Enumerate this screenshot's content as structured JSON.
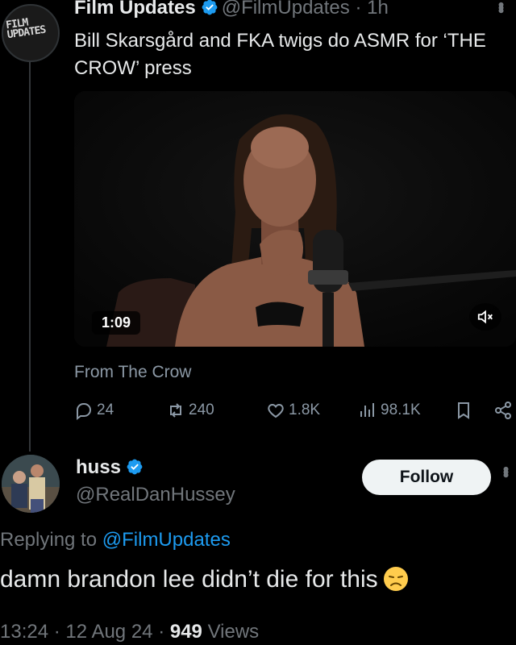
{
  "tweet": {
    "author_name": "Film Updates",
    "author_handle": "@FilmUpdates",
    "separator": "·",
    "time": "1h",
    "avatar_logo_line1": "FILM",
    "avatar_logo_line2": "UPDATES",
    "text": "Bill Skarsgård and FKA twigs do ASMR for ‘THE CROW’ press",
    "video_duration": "1:09",
    "source": "From The Crow",
    "actions": {
      "replies": "24",
      "reposts": "240",
      "likes": "1.8K",
      "views": "98.1K"
    }
  },
  "reply": {
    "author_name": "huss",
    "author_handle": "@RealDanHussey",
    "follow_label": "Follow",
    "replying_prefix": "Replying to",
    "replying_to": "@FilmUpdates",
    "text": "damn brandon lee didn’t die for this",
    "time": "13:24",
    "separator": "·",
    "date": "12 Aug 24",
    "views_count": "949",
    "views_label": "Views"
  },
  "colors": {
    "background": "#000000",
    "text": "#e7e9ea",
    "muted": "#71767b",
    "link": "#1d9bf0",
    "verified": "#1d9bf0"
  }
}
